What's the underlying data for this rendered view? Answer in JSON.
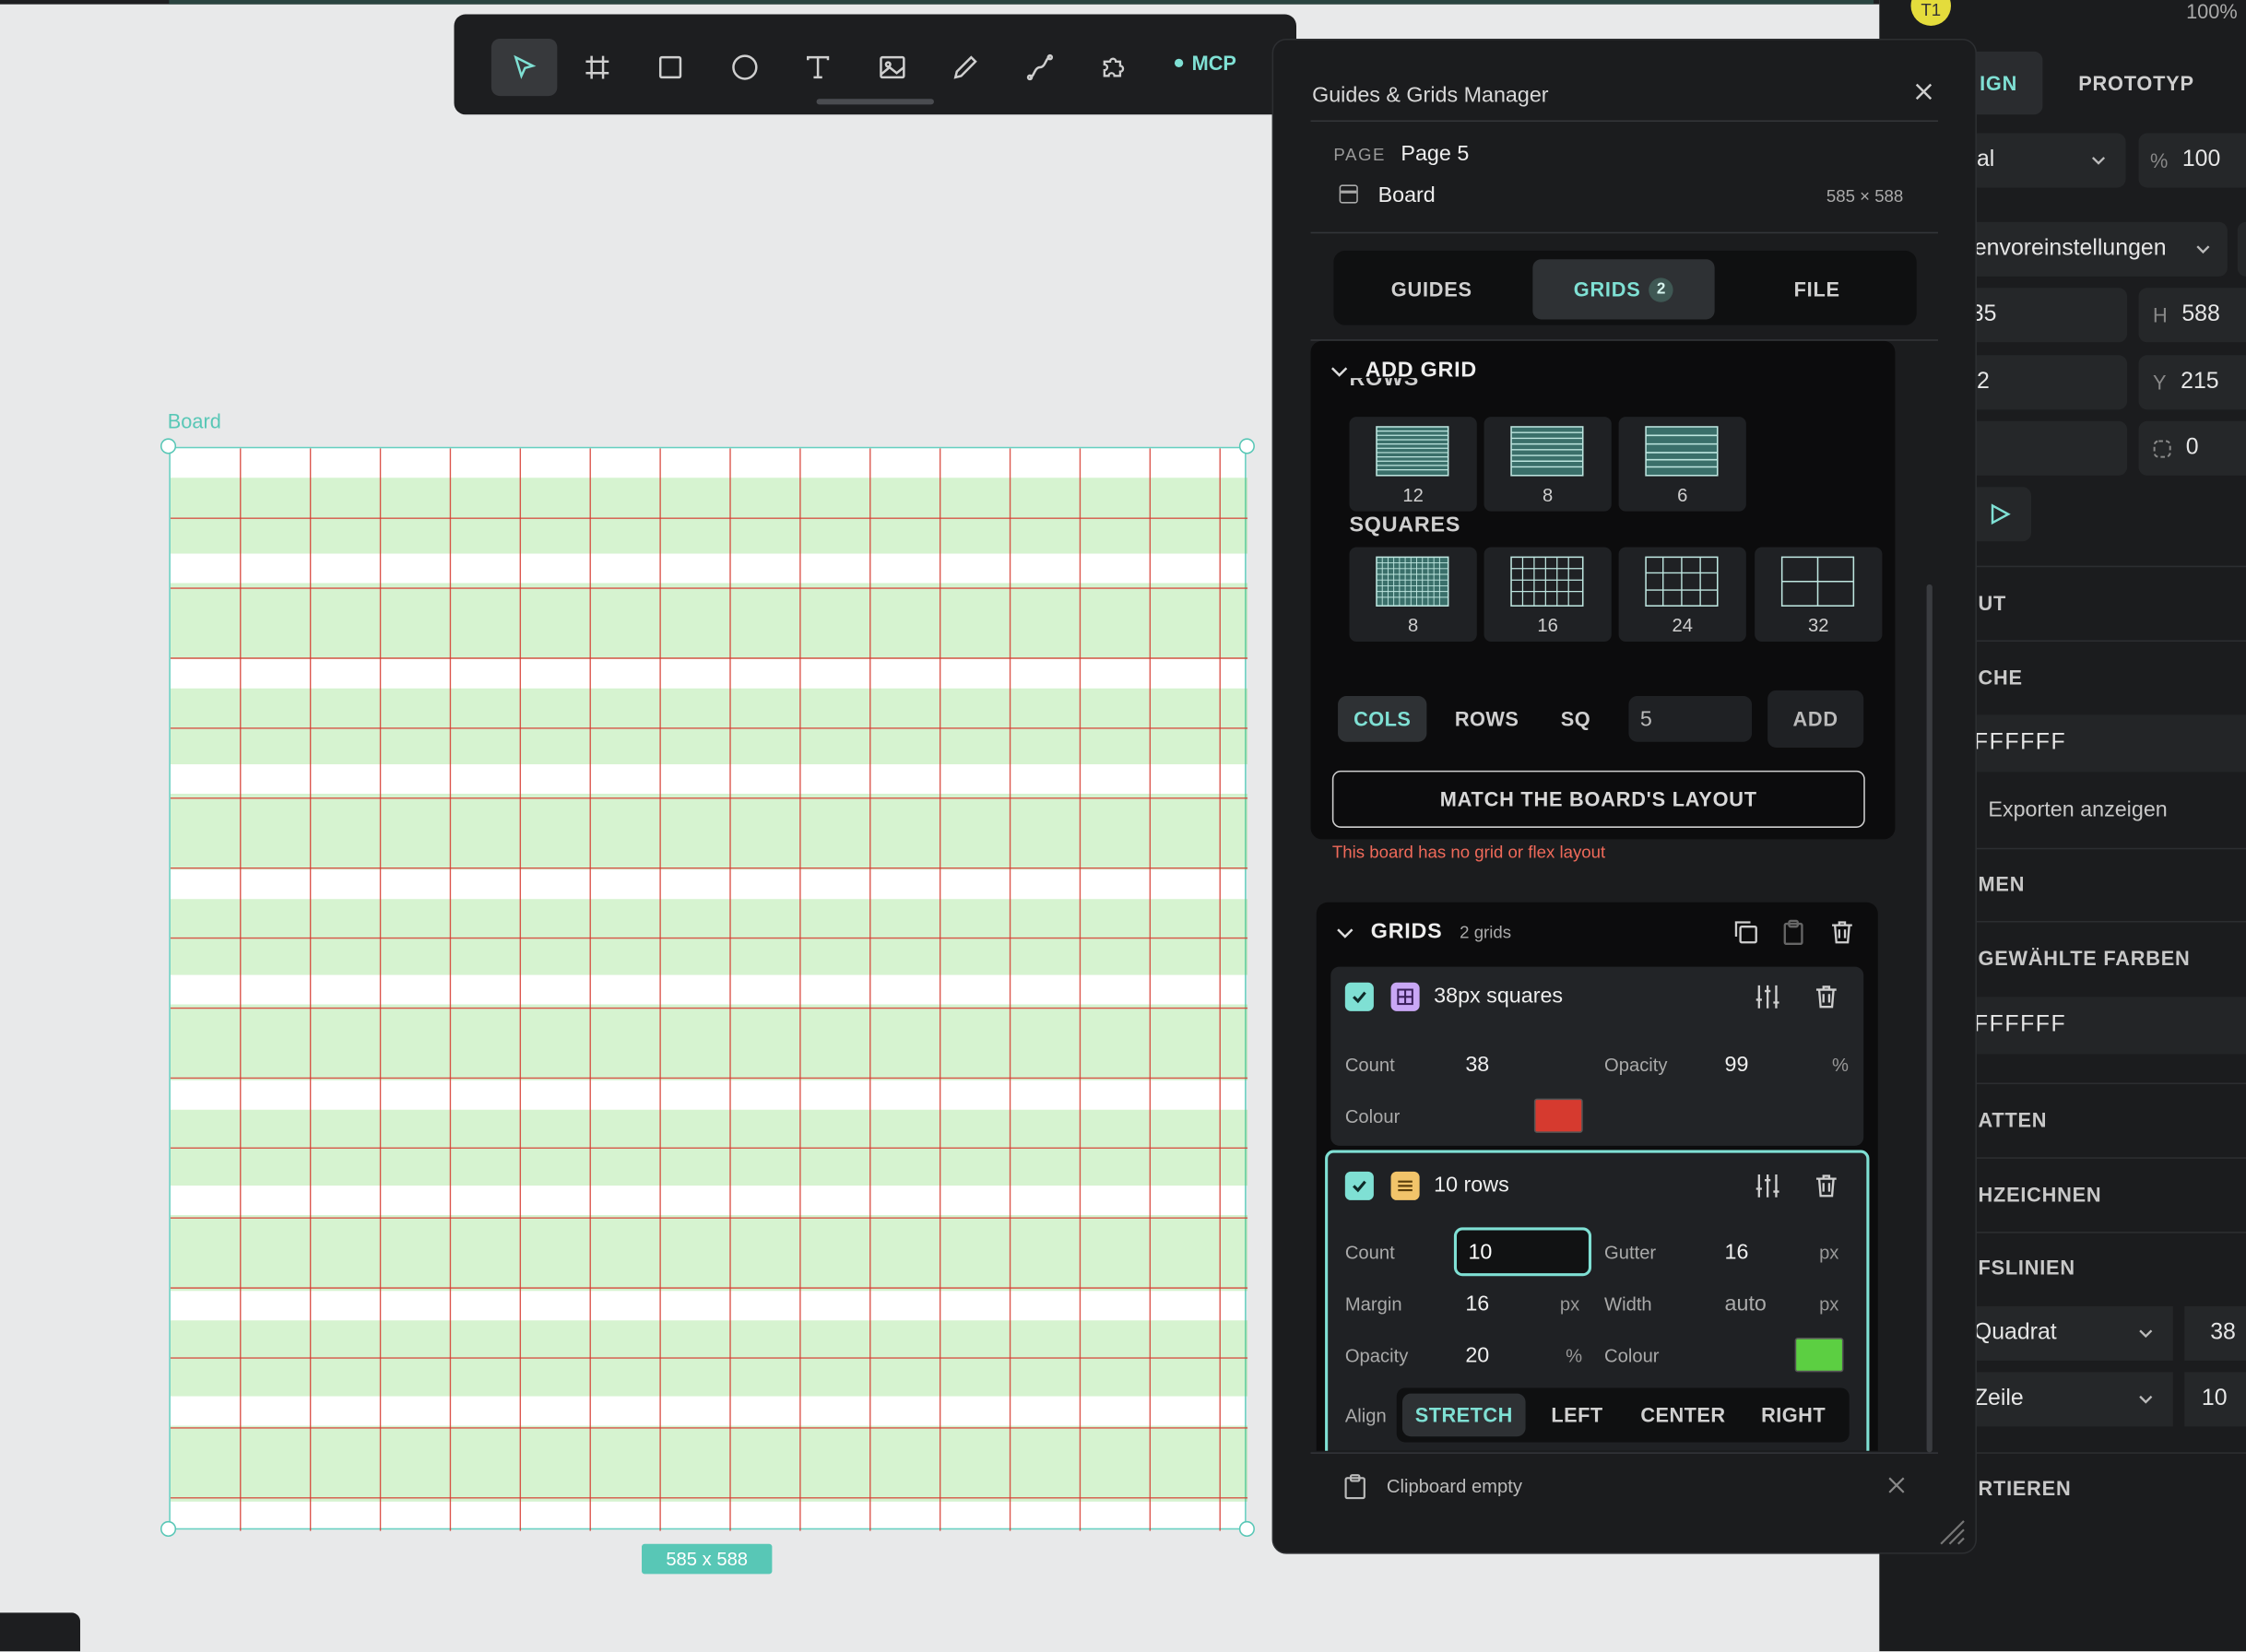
{
  "toolbar": {
    "tools": [
      "select-tool",
      "board-tool",
      "rectangle-tool",
      "ellipse-tool",
      "text-tool",
      "image-tool",
      "pencil-tool",
      "path-tool",
      "plugins-tool"
    ],
    "mcp_label": "MCP"
  },
  "canvas": {
    "board_label": "Board",
    "size_badge": "585 x 588",
    "grid_colors": {
      "squares": "#d63a2f",
      "rows": "#5ccf42"
    }
  },
  "right_panel": {
    "avatar": "T1",
    "zoom": "100%",
    "tab_design": "IGN",
    "tab_prototype": "PROTOTYP",
    "blend": "al",
    "opacity_label": "%",
    "opacity": "100",
    "preset": "envoreinstellungen",
    "w_value": "35",
    "h_label": "H",
    "h_value": "588",
    "x_value": "2",
    "y_label": "Y",
    "y_value": "215",
    "radius_value": "0",
    "sections": {
      "layout": "UT",
      "fill": "CHE",
      "fill_color": "FFFFFF",
      "show_exports": "Exporten anzeigen",
      "stroke": "MEN",
      "selected_colors": "GEWÄHLTE FARBEN",
      "selected_color": "FFFFFF",
      "shadow": "ATTEN",
      "guides": "HZEICHNEN",
      "grid_lines": "FSLINIEN",
      "grid1_type": "Quadrat",
      "grid1_value": "38",
      "grid2_type": "Zeile",
      "grid2_value": "10",
      "export": "RTIEREN"
    }
  },
  "modal": {
    "title": "Guides & Grids Manager",
    "page_label": "PAGE",
    "page_name": "Page 5",
    "board_name": "Board",
    "board_size": "585 × 588",
    "tabs": {
      "guides": "GUIDES",
      "grids": "GRIDS",
      "grids_count": "2",
      "file": "FILE"
    },
    "add_grid": {
      "title": "ADD GRID",
      "rows_label": "ROWS",
      "rows_presets": [
        "12",
        "8",
        "6"
      ],
      "squares_label": "SQUARES",
      "squares_presets": [
        "8",
        "16",
        "24",
        "32"
      ],
      "mode_cols": "COLS",
      "mode_rows": "ROWS",
      "mode_sq": "SQ",
      "count_value": "5",
      "add_label": "ADD",
      "match_label": "MATCH THE BOARD'S LAYOUT",
      "warning": "This board has no grid or flex layout"
    },
    "grids": {
      "title": "GRIDS",
      "subtitle": "2 grids",
      "grid1": {
        "title": "38px squares",
        "count_label": "Count",
        "count": "38",
        "opacity_label": "Opacity",
        "opacity": "99",
        "opacity_unit": "%",
        "colour_label": "Colour",
        "colour": "#d63a2f"
      },
      "grid2": {
        "title": "10 rows",
        "count_label": "Count",
        "count": "10",
        "gutter_label": "Gutter",
        "gutter": "16",
        "gutter_unit": "px",
        "margin_label": "Margin",
        "margin": "16",
        "margin_unit": "px",
        "width_label": "Width",
        "width": "auto",
        "width_unit": "px",
        "opacity_label": "Opacity",
        "opacity": "20",
        "opacity_unit": "%",
        "colour_label": "Colour",
        "colour": "#5ccf42",
        "align_label": "Align",
        "align_options": [
          "STRETCH",
          "LEFT",
          "CENTER",
          "RIGHT"
        ],
        "align_selected": "STRETCH"
      }
    },
    "clipboard": "Clipboard empty"
  }
}
